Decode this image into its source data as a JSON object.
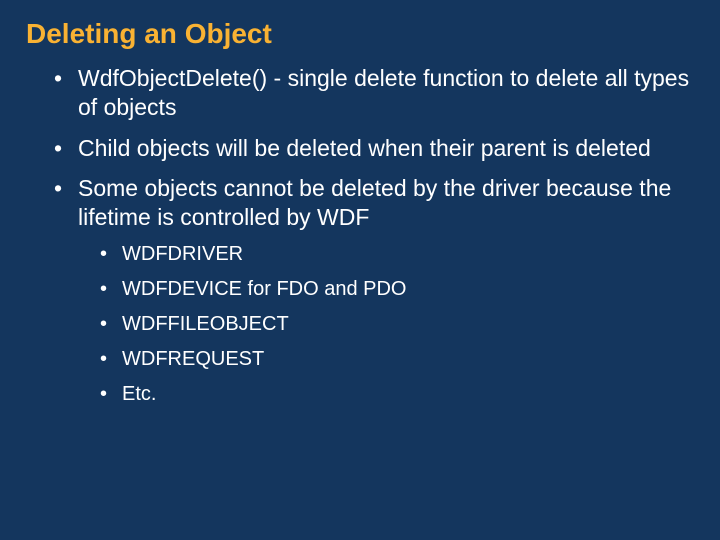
{
  "title": "Deleting an Object",
  "bullets": [
    {
      "text": "WdfObjectDelete() - single delete function to delete all types of objects"
    },
    {
      "text": "Child objects will be deleted when their parent is deleted"
    },
    {
      "text": "Some objects cannot be deleted by the driver because the lifetime is controlled by WDF",
      "sub": [
        "WDFDRIVER",
        "WDFDEVICE for FDO and PDO",
        "WDFFILEOBJECT",
        "WDFREQUEST",
        "Etc."
      ]
    }
  ]
}
